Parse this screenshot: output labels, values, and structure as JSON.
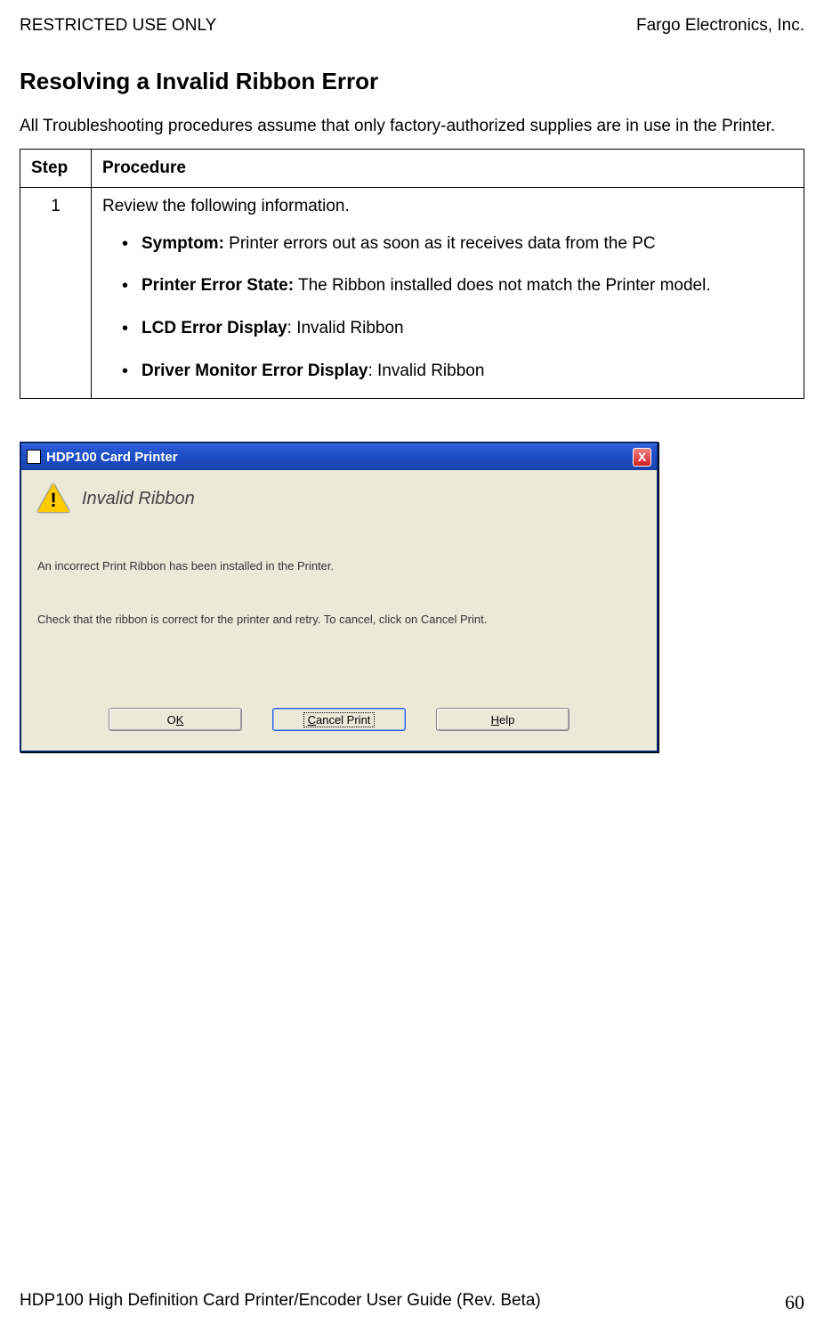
{
  "header": {
    "left": "RESTRICTED USE ONLY",
    "right": "Fargo Electronics, Inc."
  },
  "heading": "Resolving a Invalid Ribbon Error",
  "intro": "All Troubleshooting procedures assume that only factory-authorized supplies are in use in the Printer.",
  "table": {
    "col1": "Step",
    "col2": "Procedure",
    "rows": [
      {
        "step": "1",
        "lead": "Review the following information.",
        "items": [
          {
            "label": "Symptom:",
            "text": " Printer errors out as soon as it receives data from the PC"
          },
          {
            "label": "Printer Error State:",
            "text": " The Ribbon installed does not match the Printer model."
          },
          {
            "label": "LCD Error Display",
            "text": ": Invalid Ribbon"
          },
          {
            "label": "Driver Monitor Error Display",
            "text": ": Invalid Ribbon"
          }
        ]
      }
    ]
  },
  "dialog": {
    "title": "HDP100 Card Printer",
    "close": "X",
    "icon": "warning-icon",
    "heading": "Invalid Ribbon",
    "line1": "An incorrect Print Ribbon has been installed in the Printer.",
    "line2": "Check that the ribbon is correct for the printer and retry. To cancel, click on Cancel Print.",
    "buttons": {
      "ok_pre": "O",
      "ok_u": "K",
      "cancel_u": "C",
      "cancel_rest": "ancel Print",
      "help_u": "H",
      "help_rest": "elp"
    }
  },
  "footer": {
    "left": "HDP100 High Definition Card Printer/Encoder User Guide (Rev. Beta)",
    "page": "60"
  }
}
